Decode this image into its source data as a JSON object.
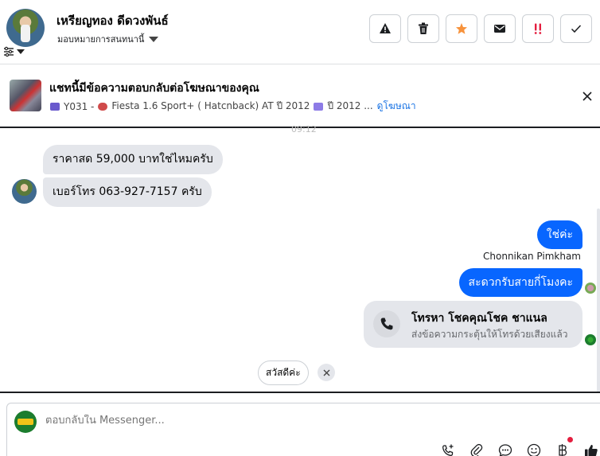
{
  "header": {
    "name": "เหรียญทอง ดีดวงพันธ์",
    "assign_label": "มอบหมายการสนทนานี้"
  },
  "ad": {
    "title": "แชทนี้มีข้อความตอบกลับต่อโฆษณาของคุณ",
    "detail": "Y031 -",
    "model": "Fiesta 1.6 Sport+ ( Hatcnback) AT ปี 2012",
    "year": "ปี 2012 ...",
    "link": "ดูโฆษณา"
  },
  "conversation": {
    "time_fragment": "09:12",
    "incoming": [
      "ราคาสด 59,000 บาทใช่ไหมครับ",
      "เบอร์โทร 063-927-7157 ครับ"
    ],
    "outgoing_1": "ใช่ค่ะ",
    "sender_name": "Chonnikan Pimkham",
    "outgoing_2": "สะดวกรับสายกี่โมงคะ",
    "call_card": {
      "title": "โทรหา โชคคุณโชค ชาแนล",
      "subtitle": "ส่งข้อความกระตุ้นให้โทรด้วยเสียงแล้ว"
    },
    "quick_reply": "สวัสดีค่ะ"
  },
  "composer": {
    "placeholder": "ตอบกลับใน Messenger..."
  },
  "colors": {
    "accent": "#0866ff",
    "star": "#f7923b",
    "alert_red": "#e41e3f"
  },
  "icons": [
    "warning-icon",
    "trash-icon",
    "star-icon",
    "mail-icon",
    "urgent-icon",
    "check-icon",
    "filter-icon",
    "close-icon",
    "phone-icon",
    "add-call-icon",
    "attachment-icon",
    "chat-bubble-icon",
    "emoji-icon",
    "baht-icon",
    "thumbs-up-icon"
  ]
}
